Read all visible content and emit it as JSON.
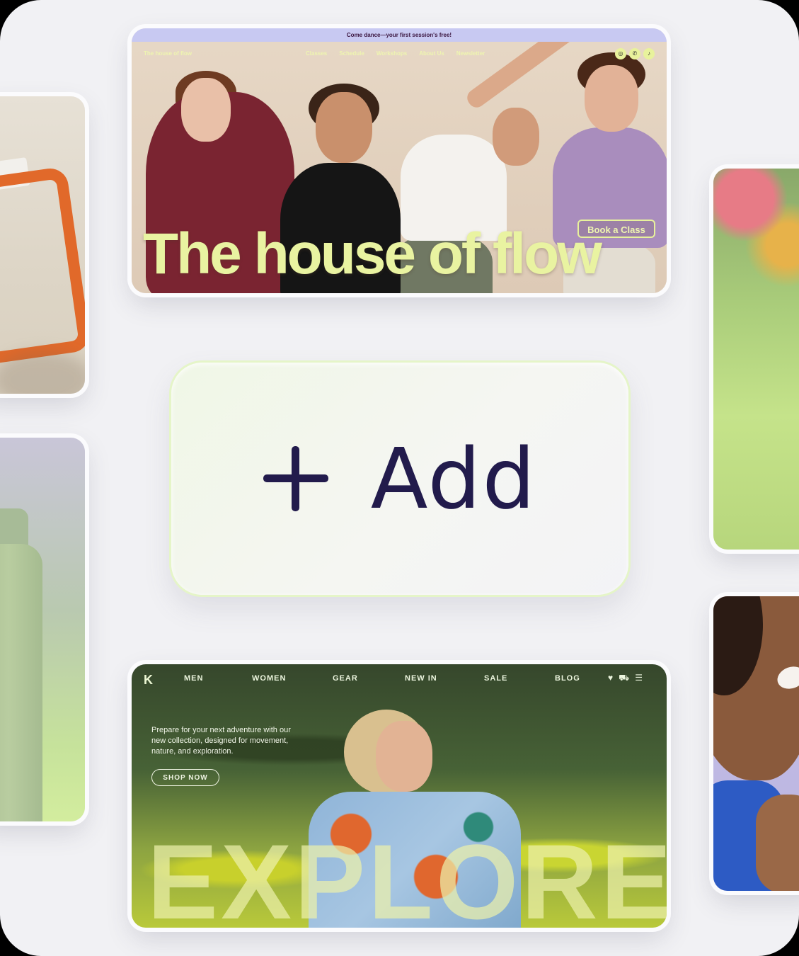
{
  "add_button": {
    "label": "Add"
  },
  "top_site": {
    "banner": "Come dance—your first session's free!",
    "brand": "The house of flow",
    "nav": [
      "Classes",
      "Schedule",
      "Workshops",
      "About Us",
      "Newsletter"
    ],
    "socials": [
      "instagram-icon",
      "whatsapp-icon",
      "tiktok-icon"
    ],
    "cta": "Book a Class",
    "headline": "The house of flow"
  },
  "bottom_site": {
    "nav": [
      "MEN",
      "WOMEN",
      "GEAR",
      "NEW IN",
      "SALE",
      "BLOG"
    ],
    "icons": [
      "heart-icon",
      "cart-icon",
      "menu-icon"
    ],
    "intro": "Prepare for your next adventure with our new collection, designed for movement, nature, and exploration.",
    "cta": "SHOP NOW",
    "headline": "EXPLORE"
  },
  "colors": {
    "accent": "#e9f3a1",
    "add_text": "#221b4c",
    "banner": "#c8c9f2"
  }
}
